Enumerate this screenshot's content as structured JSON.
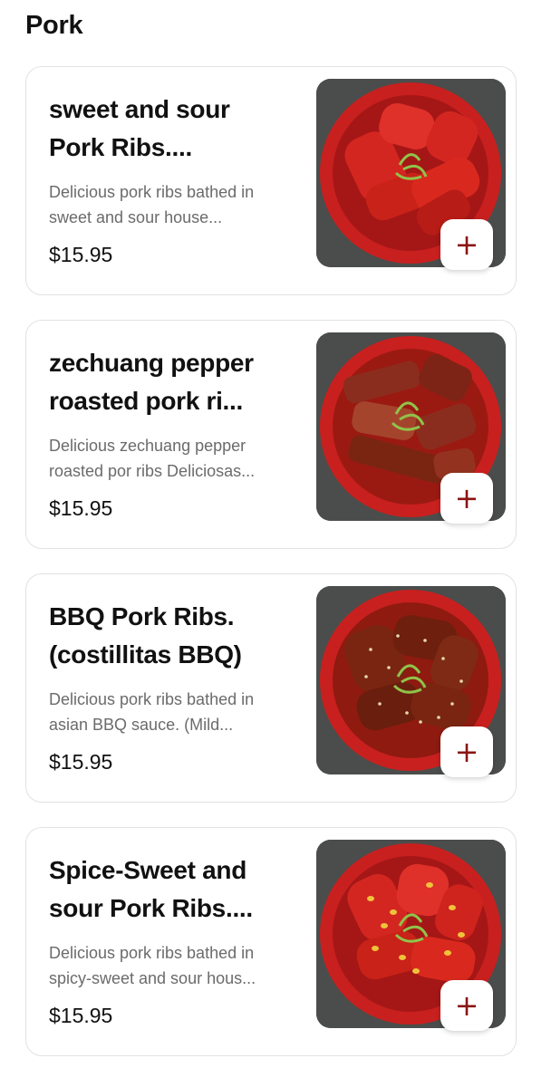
{
  "section": {
    "title": "Pork"
  },
  "items": [
    {
      "name": "sweet and sour Pork Ribs....",
      "description": "Delicious pork ribs bathed in sweet and sour house...",
      "price": "$15.95",
      "image_icon": "sweet-sour-ribs-photo",
      "add_icon": "+"
    },
    {
      "name": "zechuang pepper roasted pork ri...",
      "description": "Delicious zechuang pepper roasted por ribs Deliciosas...",
      "price": "$15.95",
      "image_icon": "pepper-roasted-ribs-photo",
      "add_icon": "+"
    },
    {
      "name": "BBQ Pork Ribs. (costillitas BBQ)",
      "description": "Delicious pork ribs bathed in asian BBQ sauce. (Mild...",
      "price": "$15.95",
      "image_icon": "bbq-ribs-photo",
      "add_icon": "+"
    },
    {
      "name": "Spice-Sweet and sour Pork Ribs....",
      "description": "Delicious pork ribs bathed in spicy-sweet and sour hous...",
      "price": "$15.95",
      "image_icon": "spicy-sweet-ribs-photo",
      "add_icon": "+"
    }
  ],
  "colors": {
    "bowl": "#c8201f",
    "bowl_inner": "#a51716",
    "photo_bg": "#4a4d4b",
    "rib_red": "#d42620",
    "rib_bbq": "#7a2512",
    "rib_roast": "#8b2d1e",
    "scallion": "#8fc34a",
    "add_icon": "#8a1414"
  }
}
